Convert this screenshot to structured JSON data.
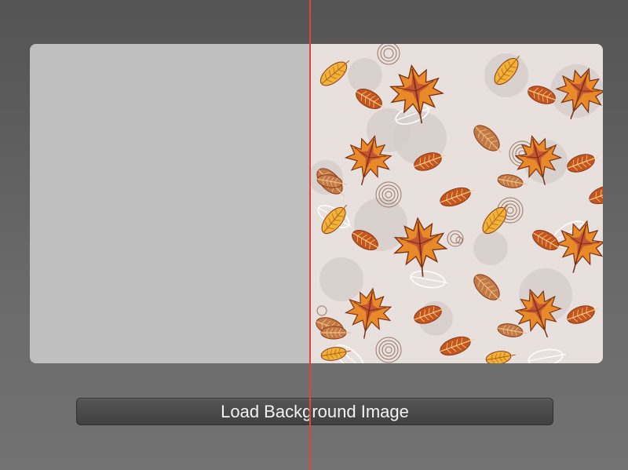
{
  "button": {
    "label": "Load Background Image"
  },
  "colors": {
    "background": "#5a5a5a",
    "placeholder_panel": "#bfbfbf",
    "pattern_background": "#e7e0dd",
    "split_line": "#d9463f",
    "button_bg": "#474747",
    "button_text": "#f2f2f2",
    "leaf_orange": "#e8892a",
    "leaf_dark_orange": "#c5551e",
    "leaf_yellow": "#f2b23a",
    "leaf_brown": "#c17a45",
    "leaf_red": "#b9443a"
  },
  "image": {
    "description_icon": "autumn-leaves-pattern"
  }
}
